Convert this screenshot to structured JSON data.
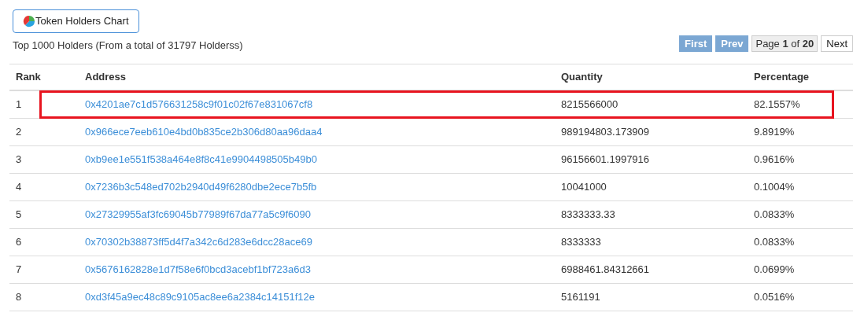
{
  "chart_button": {
    "label": "Token Holders Chart"
  },
  "summary": "Top 1000 Holders (From a total of 31797 Holderss)",
  "pager": {
    "first": {
      "label": "First",
      "disabled": true
    },
    "prev": {
      "label": "Prev",
      "disabled": true
    },
    "page_prefix": "Page",
    "page_current": "1",
    "page_of": "of",
    "page_total": "20",
    "next": {
      "label": "Next",
      "disabled": false
    }
  },
  "table": {
    "columns": [
      "Rank",
      "Address",
      "Quantity",
      "Percentage"
    ],
    "rows": [
      {
        "rank": "1",
        "address": "0x4201ae7c1d576631258c9f01c02f67e831067cf8",
        "quantity": "8215566000",
        "percentage": "82.1557%",
        "highlighted": true
      },
      {
        "rank": "2",
        "address": "0x966ece7eeb610e4bd0b835ce2b306d80aa96daa4",
        "quantity": "989194803.173909",
        "percentage": "9.8919%",
        "highlighted": false
      },
      {
        "rank": "3",
        "address": "0xb9ee1e551f538a464e8f8c41e9904498505b49b0",
        "quantity": "96156601.1997916",
        "percentage": "0.9616%",
        "highlighted": false
      },
      {
        "rank": "4",
        "address": "0x7236b3c548ed702b2940d49f6280dbe2ece7b5fb",
        "quantity": "10041000",
        "percentage": "0.1004%",
        "highlighted": false
      },
      {
        "rank": "5",
        "address": "0x27329955af3fc69045b77989f67da77a5c9f6090",
        "quantity": "8333333.33",
        "percentage": "0.0833%",
        "highlighted": false
      },
      {
        "rank": "6",
        "address": "0x70302b38873ff5d4f7a342c6d283e6dcc28ace69",
        "quantity": "8333333",
        "percentage": "0.0833%",
        "highlighted": false
      },
      {
        "rank": "7",
        "address": "0x5676162828e1d7f58e6f0bcd3acebf1bf723a6d3",
        "quantity": "6988461.84312661",
        "percentage": "0.0699%",
        "highlighted": false
      },
      {
        "rank": "8",
        "address": "0xd3f45a9ec48c89c9105ac8ee6a2384c14151f12e",
        "quantity": "5161191",
        "percentage": "0.0516%",
        "highlighted": false
      }
    ]
  }
}
